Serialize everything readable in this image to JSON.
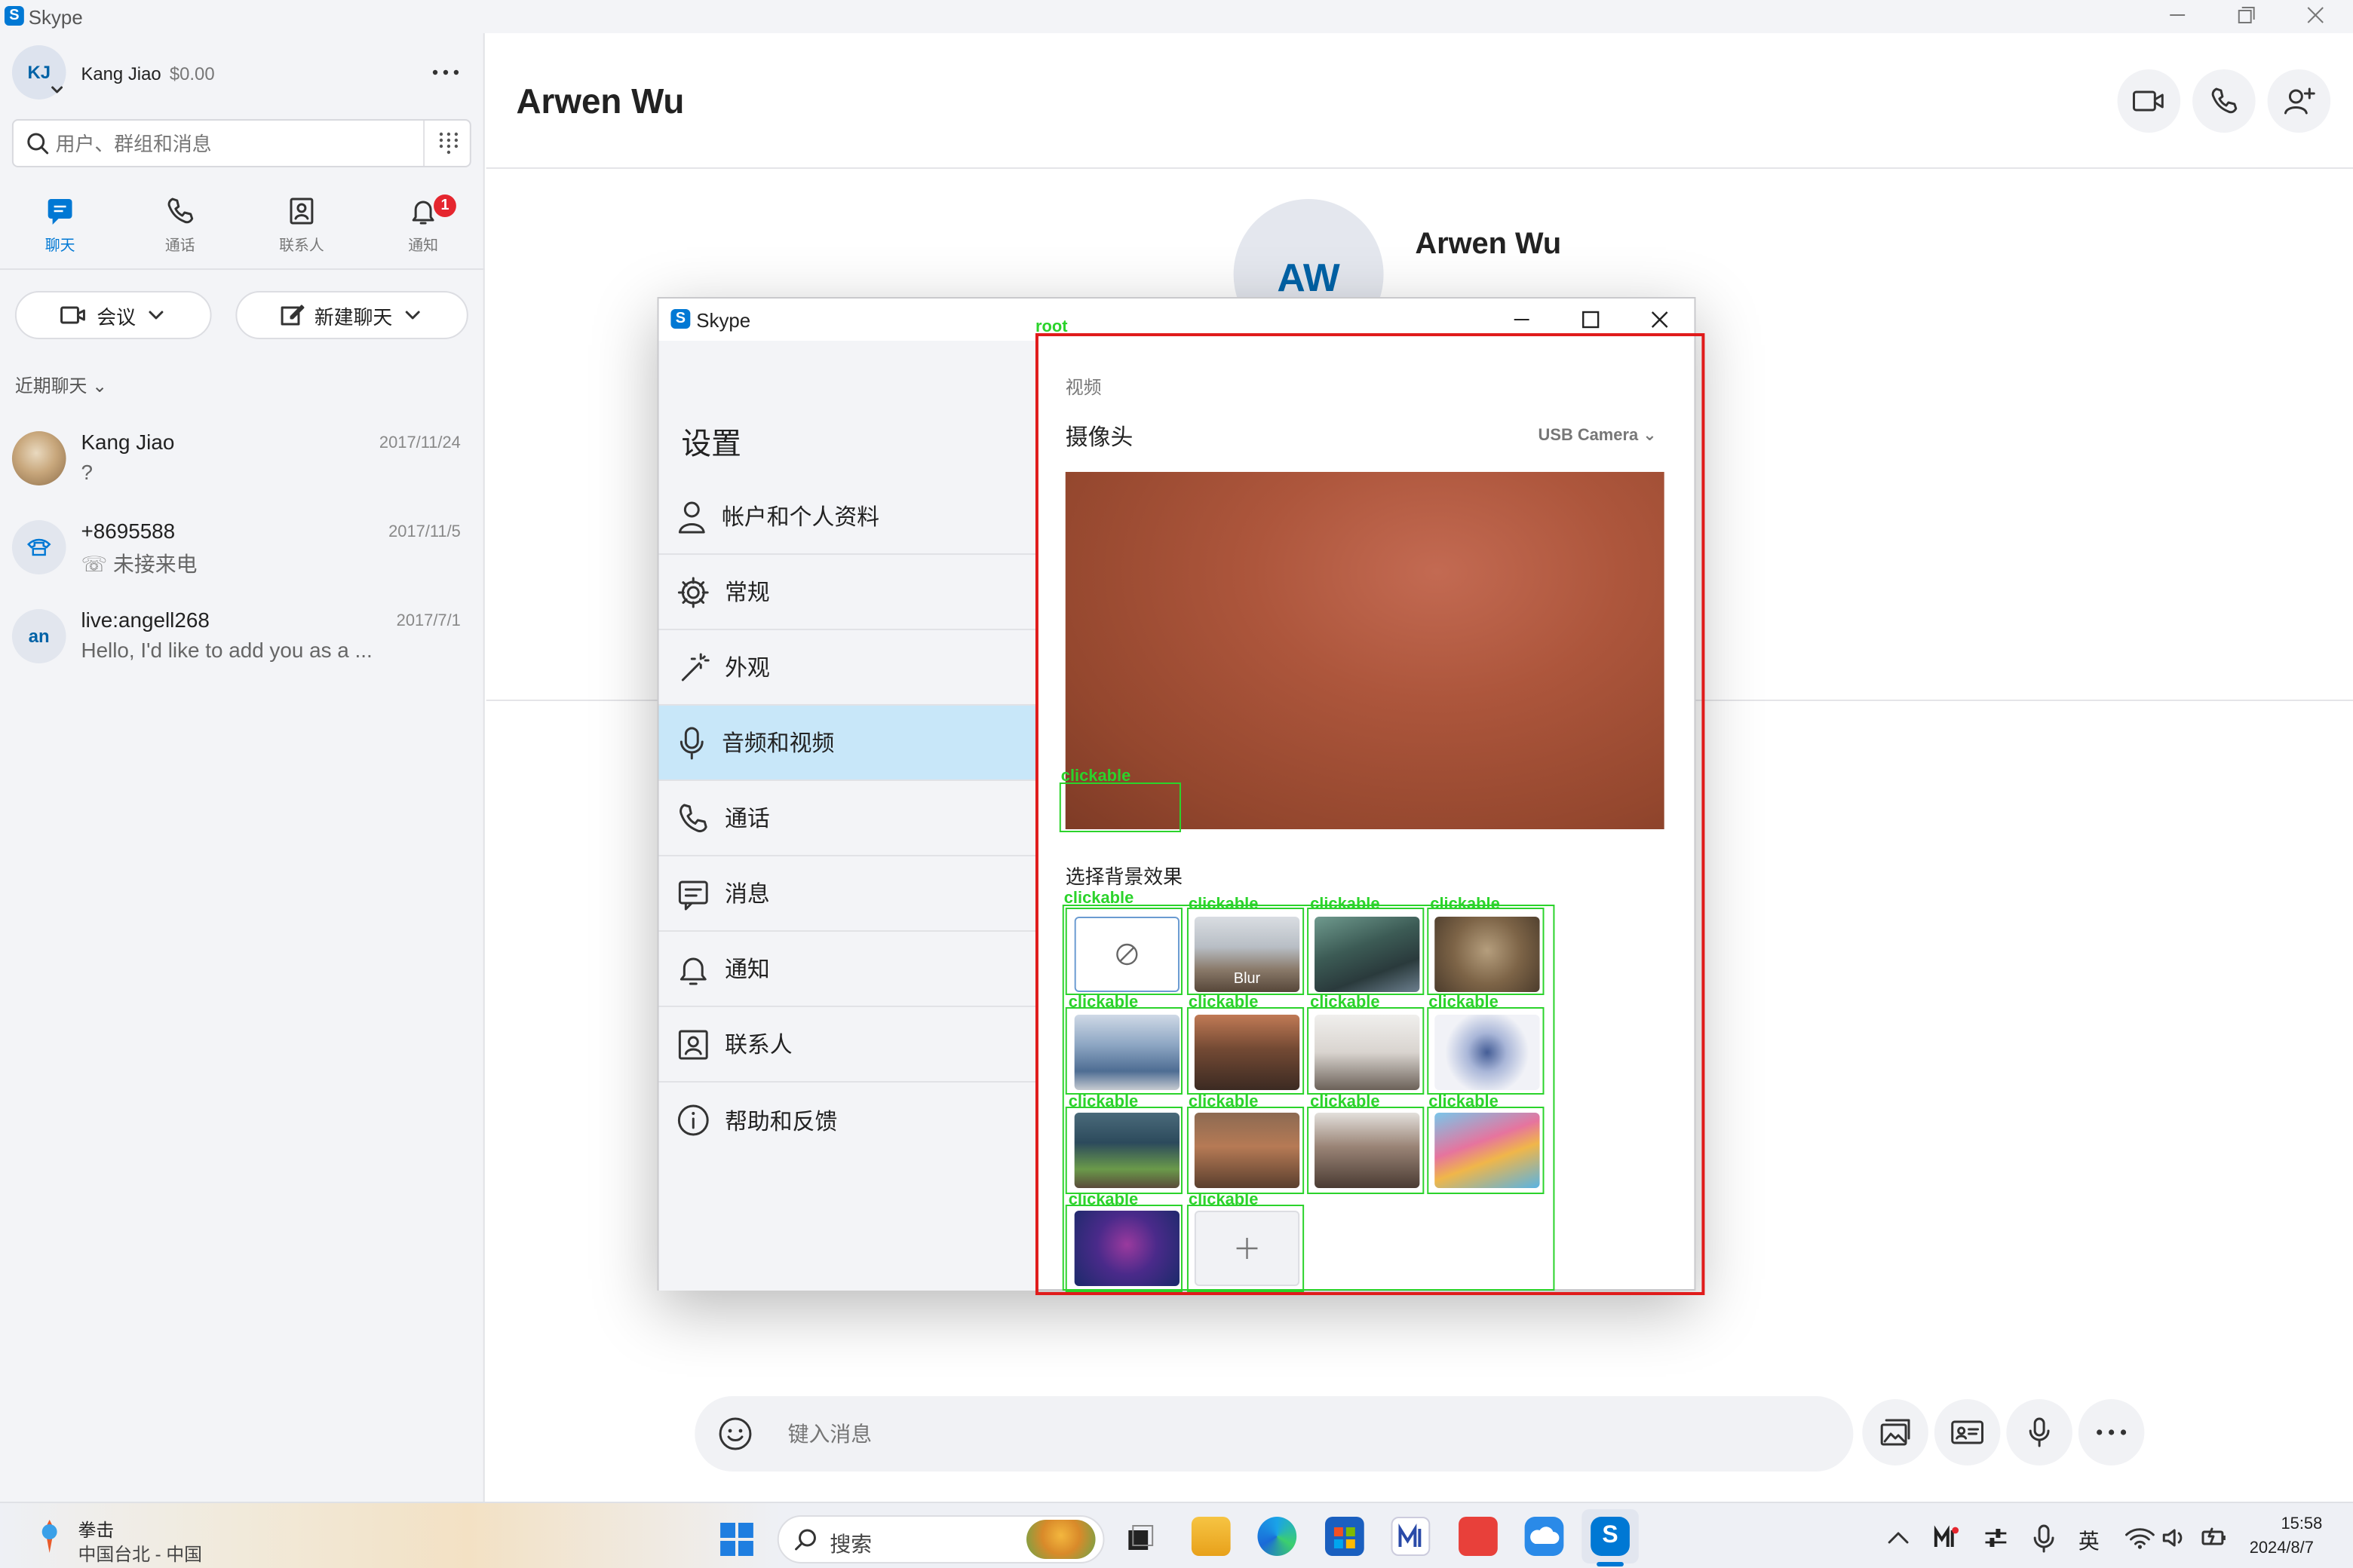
{
  "app": {
    "title": "Skype"
  },
  "profile": {
    "initials": "KJ",
    "name": "Kang Jiao",
    "balance": "$0.00"
  },
  "search": {
    "placeholder": "用户、群组和消息"
  },
  "nav": [
    {
      "label": "聊天",
      "icon": "chat-icon",
      "active": true
    },
    {
      "label": "通话",
      "icon": "phone-icon"
    },
    {
      "label": "联系人",
      "icon": "contacts-icon"
    },
    {
      "label": "通知",
      "icon": "bell-icon",
      "badge": "1"
    }
  ],
  "actions": {
    "meeting": "会议",
    "new_chat": "新建聊天"
  },
  "recent": {
    "heading": "近期聊天"
  },
  "chats": [
    {
      "name": "Kang Jiao",
      "date": "2017/11/24",
      "preview": "?"
    },
    {
      "name": "+8695588",
      "date": "2017/11/5",
      "preview": "未接来电"
    },
    {
      "name": "live:angell268",
      "date": "2017/7/1",
      "preview": "Hello, I'd like to add you as a ...",
      "initials": "an"
    }
  ],
  "conversation": {
    "title": "Arwen Wu",
    "profile_name": "Arwen Wu",
    "initials": "AW"
  },
  "compose": {
    "placeholder": "键入消息"
  },
  "settings": {
    "window_title": "Skype",
    "heading": "设置",
    "menu": [
      {
        "label": "帐户和个人资料",
        "icon": "person-icon"
      },
      {
        "label": "常规",
        "icon": "gear-icon"
      },
      {
        "label": "外观",
        "icon": "magic-wand-icon"
      },
      {
        "label": "音频和视频",
        "icon": "microphone-icon",
        "active": true
      },
      {
        "label": "通话",
        "icon": "phone-icon"
      },
      {
        "label": "消息",
        "icon": "message-icon"
      },
      {
        "label": "通知",
        "icon": "bell-icon"
      },
      {
        "label": "联系人",
        "icon": "contacts-icon"
      },
      {
        "label": "帮助和反馈",
        "icon": "info-icon"
      }
    ],
    "video": {
      "section_label": "视频",
      "camera_label": "摄像头",
      "camera_value": "USB Camera",
      "background_label": "选择背景效果",
      "blur_label": "Blur"
    }
  },
  "annotations": {
    "root_label": "root",
    "clickable_label": "clickable"
  },
  "taskbar": {
    "weather_title": "拳击",
    "weather_sub": "中国台北 - 中国",
    "search_label": "搜索",
    "ime_label": "英",
    "time": "15:58",
    "date": "2024/8/7"
  },
  "colors": {
    "accent": "#0078d4",
    "active_menu": "#c8e7f9",
    "annotation_green": "#2bd32b",
    "annotation_red": "#e01b1b"
  }
}
